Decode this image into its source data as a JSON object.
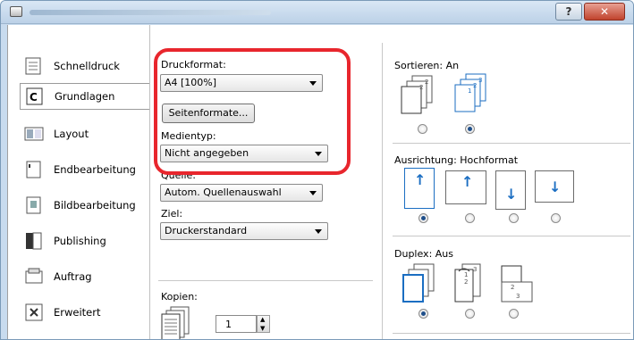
{
  "sidebar": {
    "items": [
      {
        "label": "Schnelldruck",
        "icon": "quick-print-icon"
      },
      {
        "label": "Grundlagen",
        "icon": "basic-icon",
        "active": true
      },
      {
        "label": "Layout",
        "icon": "layout-icon"
      },
      {
        "label": "Endbearbeitung",
        "icon": "finishing-icon"
      },
      {
        "label": "Bildbearbeitung",
        "icon": "imaging-icon"
      },
      {
        "label": "Publishing",
        "icon": "publishing-icon"
      },
      {
        "label": "Auftrag",
        "icon": "job-icon"
      },
      {
        "label": "Erweitert",
        "icon": "advanced-icon"
      }
    ]
  },
  "basic": {
    "paper_size_label": "Druckformat:",
    "paper_size_value": "A4 [100%]",
    "page_sizes_button": "Seitenformate...",
    "media_type_label": "Medientyp:",
    "media_type_value": "Nicht angegeben",
    "source_label": "Quelle:",
    "source_value": "Autom. Quellenauswahl",
    "destination_label": "Ziel:",
    "destination_value": "Druckerstandard",
    "copies_label": "Kopien:",
    "copies_value": "1"
  },
  "collate": {
    "label": "Sortieren:",
    "value": "An"
  },
  "orientation": {
    "label": "Ausrichtung:",
    "value": "Hochformat"
  },
  "duplex": {
    "label": "Duplex:",
    "value": "Aus"
  },
  "colors": {
    "highlight": "#e8262d",
    "accent": "#1b6ec2"
  }
}
